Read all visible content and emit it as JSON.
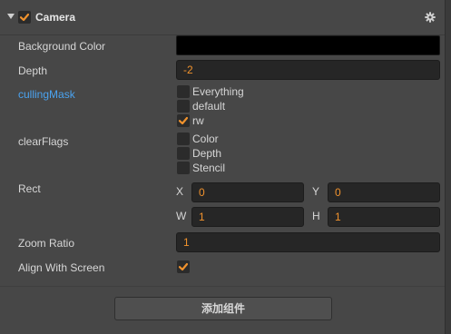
{
  "header": {
    "title": "Camera",
    "enabled": true
  },
  "rows": {
    "background_color": {
      "label": "Background Color",
      "value": "#000000"
    },
    "depth": {
      "label": "Depth",
      "value": "-2"
    },
    "culling_mask": {
      "label": "cullingMask",
      "options": [
        {
          "label": "Everything",
          "checked": false
        },
        {
          "label": "default",
          "checked": false
        },
        {
          "label": "rw",
          "checked": true
        }
      ]
    },
    "clear_flags": {
      "label": "clearFlags",
      "options": [
        {
          "label": "Color",
          "checked": false
        },
        {
          "label": "Depth",
          "checked": false
        },
        {
          "label": "Stencil",
          "checked": false
        }
      ]
    },
    "rect": {
      "label": "Rect",
      "x_label": "X",
      "x": "0",
      "y_label": "Y",
      "y": "0",
      "w_label": "W",
      "w": "1",
      "h_label": "H",
      "h": "1"
    },
    "zoom_ratio": {
      "label": "Zoom Ratio",
      "value": "1"
    },
    "align_with_screen": {
      "label": "Align With Screen",
      "checked": true
    }
  },
  "add_component_label": "添加组件",
  "colors": {
    "accent": "#f0922d",
    "link": "#4aa3f0",
    "panel": "#474747",
    "field": "#262626"
  }
}
